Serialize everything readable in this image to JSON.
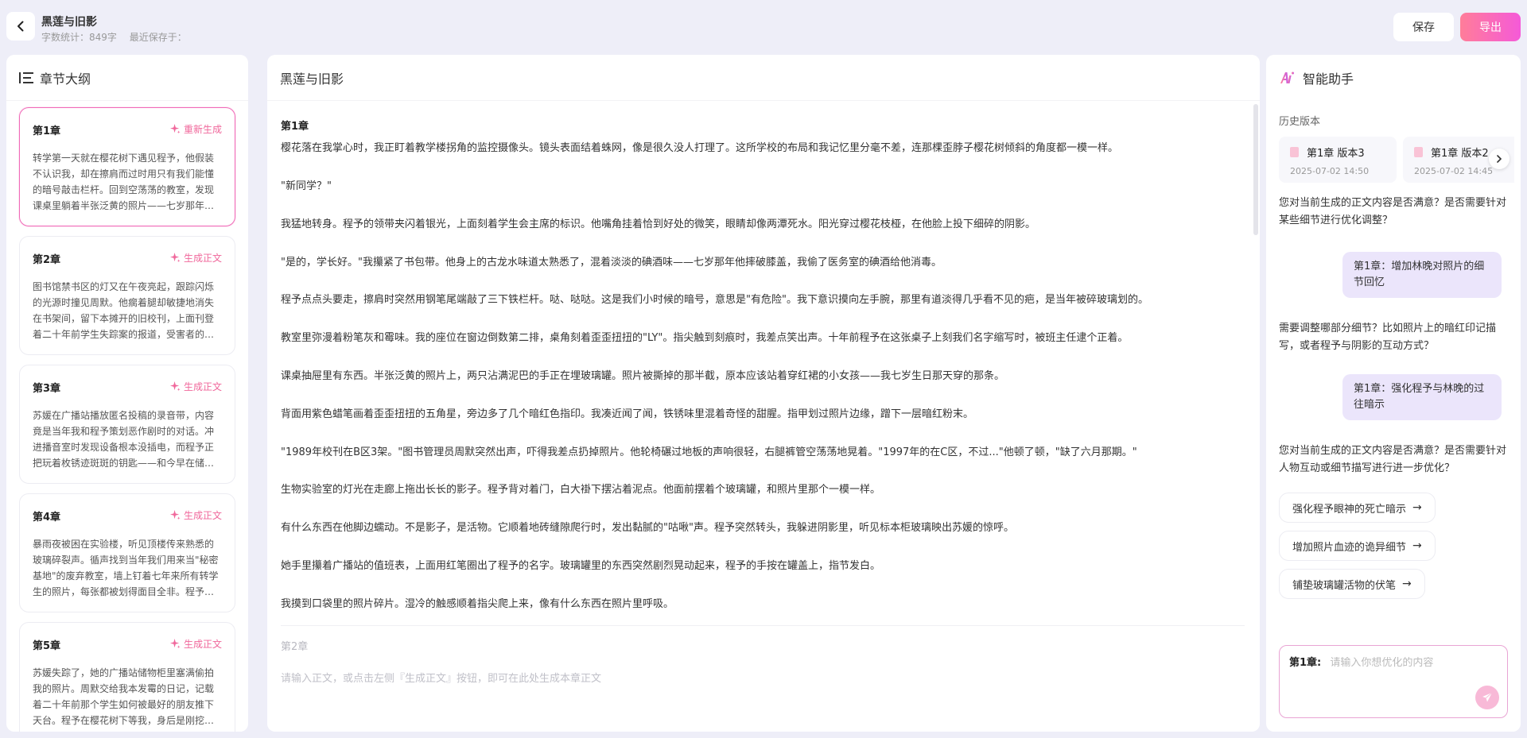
{
  "header": {
    "title": "黑莲与旧影",
    "word_count": "字数统计：849字",
    "last_saved": "最近保存于：",
    "save_label": "保存",
    "export_label": "导出"
  },
  "outline": {
    "title": "章节大纲",
    "chapters": [
      {
        "title": "第1章",
        "action": "重新生成",
        "body": "转学第一天就在樱花树下遇见程予，他假装不认识我，却在擦肩而过时用只有我们能懂的暗号敲击栏杆。回到空荡荡的教室，发现课桌里躺着半张泛黄的照片——七岁那年的我。"
      },
      {
        "title": "第2章",
        "action": "生成正文",
        "body": "图书馆禁书区的灯又在午夜亮起，跟踪闪烁的光源时撞见周默。他瘸着腿却敏捷地消失在书架间，留下本摊开的旧校刊，上面刊登着二十年前学生失踪案的报道，受害者的名字被人用红笔圈起。"
      },
      {
        "title": "第3章",
        "action": "生成正文",
        "body": "苏媛在广播站播放匿名投稿的录音带，内容竟是当年我和程予策划恶作剧时的对话。冲进播音室时发现设备根本没插电，而程予正把玩着枚锈迹斑斑的钥匙——和今早在储物柜发现的那把一模一样。"
      },
      {
        "title": "第4章",
        "action": "生成正文",
        "body": "暴雨夜被困在实验楼，听见顶楼传来熟悉的玻璃碎裂声。循声找到当年我们用来当\"秘密基地\"的废弃教室，墙上钉着七年来所有转学生的照片，每张都被划得面目全非。程予站在窗边，手里攥着我丢失的发卡。"
      },
      {
        "title": "第5章",
        "action": "生成正文",
        "body": "苏媛失踪了，她的广播站储物柜里塞满偷拍我的照片。周默交给我本发霉的日记，记载着二十年前那个学生如何被最好的朋友推下天台。程予在樱花树下等我，身后是刚挖开的泥土。"
      }
    ]
  },
  "editor": {
    "title": "黑莲与旧影",
    "chapter1_title": "第1章",
    "paragraphs": [
      "樱花落在我掌心时，我正盯着教学楼拐角的监控摄像头。镜头表面结着蛛网，像是很久没人打理了。这所学校的布局和我记忆里分毫不差，连那棵歪脖子樱花树倾斜的角度都一模一样。",
      "\"新同学？\"",
      "我猛地转身。程予的领带夹闪着银光，上面刻着学生会主席的标识。他嘴角挂着恰到好处的微笑，眼睛却像两潭死水。阳光穿过樱花枝桠，在他脸上投下细碎的阴影。",
      "\"是的，学长好。\"我攥紧了书包带。他身上的古龙水味道太熟悉了，混着淡淡的碘酒味——七岁那年他摔破膝盖，我偷了医务室的碘酒给他消毒。",
      "程予点点头要走，擦肩时突然用钢笔尾端敲了三下铁栏杆。哒、哒哒。这是我们小时候的暗号，意思是\"有危险\"。我下意识摸向左手腕，那里有道淡得几乎看不见的疤，是当年被碎玻璃划的。",
      "教室里弥漫着粉笔灰和霉味。我的座位在窗边倒数第二排，桌角刻着歪歪扭扭的\"LY\"。指尖触到刻痕时，我差点笑出声。十年前程予在这张桌子上刻我们名字缩写时，被班主任逮个正着。",
      "课桌抽屉里有东西。半张泛黄的照片上，两只沾满泥巴的手正在埋玻璃罐。照片被撕掉的那半截，原本应该站着穿红裙的小女孩——我七岁生日那天穿的那条。",
      "背面用紫色蜡笔画着歪歪扭扭的五角星，旁边多了几个暗红色指印。我凑近闻了闻，铁锈味里混着奇怪的甜腥。指甲划过照片边缘，蹭下一层暗红粉末。",
      "\"1989年校刊在B区3架。\"图书管理员周默突然出声，吓得我差点扔掉照片。他轮椅碾过地板的声响很轻，右腿裤管空荡荡地晃着。\"1997年的在C区，不过...\"他顿了顿，\"缺了六月那期。\"",
      "生物实验室的灯光在走廊上拖出长长的影子。程予背对着门，白大褂下摆沾着泥点。他面前摆着个玻璃罐，和照片里那个一模一样。",
      "有什么东西在他脚边蠕动。不是影子，是活物。它顺着地砖缝隙爬行时，发出黏腻的\"咕啾\"声。程予突然转头，我躲进阴影里，听见标本柜玻璃映出苏媛的惊呼。",
      "她手里攥着广播站的值班表，上面用红笔圈出了程予的名字。玻璃罐里的东西突然剧烈晃动起来，程予的手按在罐盖上，指节发白。",
      "我摸到口袋里的照片碎片。湿冷的触感顺着指尖爬上来，像有什么东西在照片里呼吸。"
    ],
    "chapter2_title": "第2章",
    "chapter2_placeholder": "请输入正文，或点击左侧『生成正文』按钮，即可在此处生成本章正文"
  },
  "assistant": {
    "title": "智能助手",
    "history_label": "历史版本",
    "versions": [
      {
        "name": "第1章 版本3",
        "date": "2025-07-02 14:50"
      },
      {
        "name": "第1章 版本2",
        "date": "2025-07-02 14:45"
      }
    ],
    "messages": {
      "bot1": "您对当前生成的正文内容是否满意？是否需要针对某些细节进行优化调整？",
      "user1": "第1章：增加林晚对照片的细节回忆",
      "bot2": "需要调整哪部分细节？比如照片上的暗红印记描写，或者程予与阴影的互动方式？",
      "user2": "第1章：强化程予与林晚的过往暗示",
      "bot3": "您对当前生成的正文内容是否满意？是否需要针对人物互动或细节描写进行进一步优化？"
    },
    "suggestions": [
      "强化程予眼神的死亡暗示",
      "增加照片血迹的诡异细节",
      "铺垫玻璃罐活物的伏笔"
    ],
    "input_prefix": "第1章:",
    "input_placeholder": "请输入你想优化的内容"
  },
  "colors": {
    "accent_pink": "#f0679b",
    "export_gradient_start": "#ff7d99",
    "export_gradient_end": "#f55ad8",
    "user_bubble": "#ebe5fb",
    "page_bg": "#eeeef8"
  },
  "icons": {
    "back": "chevron-left-icon",
    "outline": "list-outline-icon",
    "regenerate": "sparkle-icon",
    "assistant": "ai-logo-icon",
    "version": "document-icon",
    "next": "chevron-right-icon",
    "suggestion": "arrow-right-icon",
    "send": "paper-plane-icon"
  }
}
